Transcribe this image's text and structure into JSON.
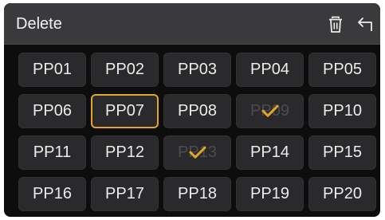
{
  "header": {
    "title": "Delete",
    "trash_icon": "trash-icon",
    "back_icon": "back-arrow-icon"
  },
  "colors": {
    "accent": "#e2a528",
    "tile_bg": "#2a2a2c",
    "header_bg": "#3a3a3c"
  },
  "presets": [
    {
      "label": "PP01",
      "state": "normal"
    },
    {
      "label": "PP02",
      "state": "normal"
    },
    {
      "label": "PP03",
      "state": "normal"
    },
    {
      "label": "PP04",
      "state": "normal"
    },
    {
      "label": "PP05",
      "state": "normal"
    },
    {
      "label": "PP06",
      "state": "normal"
    },
    {
      "label": "PP07",
      "state": "selected"
    },
    {
      "label": "PP08",
      "state": "normal"
    },
    {
      "label": "PP09",
      "state": "checked"
    },
    {
      "label": "PP10",
      "state": "normal"
    },
    {
      "label": "PP11",
      "state": "normal"
    },
    {
      "label": "PP12",
      "state": "normal"
    },
    {
      "label": "PP13",
      "state": "checked"
    },
    {
      "label": "PP14",
      "state": "normal"
    },
    {
      "label": "PP15",
      "state": "normal"
    },
    {
      "label": "PP16",
      "state": "normal"
    },
    {
      "label": "PP17",
      "state": "normal"
    },
    {
      "label": "PP18",
      "state": "normal"
    },
    {
      "label": "PP19",
      "state": "normal"
    },
    {
      "label": "PP20",
      "state": "normal"
    }
  ]
}
